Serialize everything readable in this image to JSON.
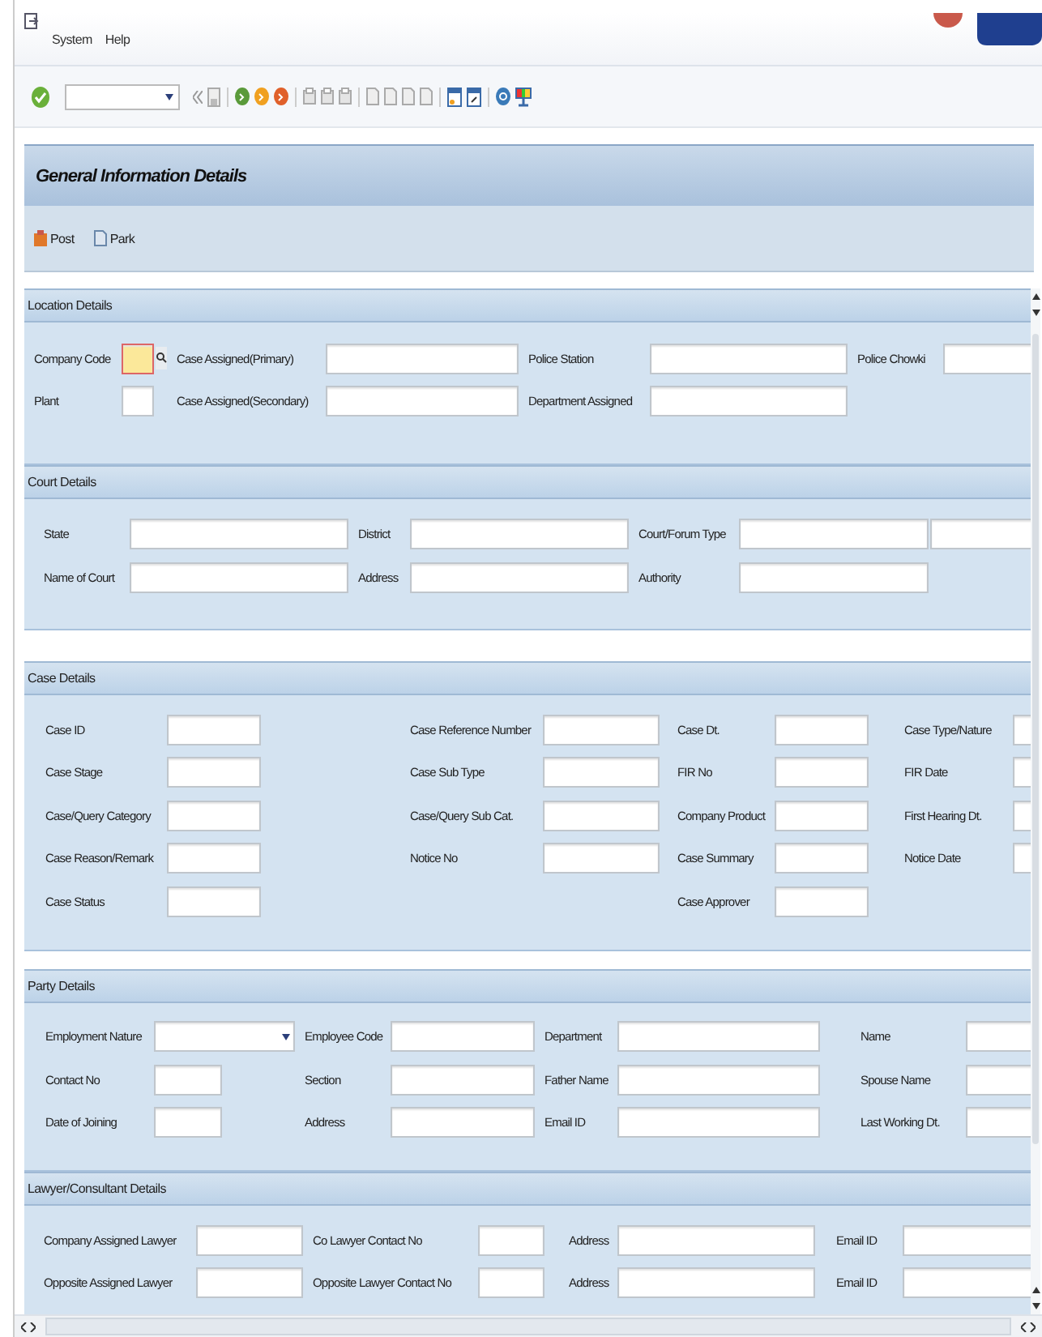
{
  "menu": [
    "System",
    "Help"
  ],
  "title": "General Information Details",
  "actions": [
    "Post",
    "Park"
  ],
  "sections": [
    {
      "title": "Location Details",
      "rows": [
        [
          {
            "label": "Company Code",
            "kind": "lookup"
          },
          {
            "label": "Case Assigned(Primary)",
            "kind": "text"
          },
          {
            "label": "Police Station",
            "kind": "text"
          },
          {
            "label": "Police Chowki",
            "kind": "text"
          }
        ],
        [
          {
            "label": "Plant",
            "kind": "text"
          },
          {
            "label": "Case Assigned(Secondary)",
            "kind": "text"
          },
          {
            "label": "Department Assigned",
            "kind": "text"
          },
          null
        ]
      ]
    },
    {
      "title": "Court Details",
      "rows": [
        [
          {
            "label": "State",
            "kind": "text"
          },
          {
            "label": "District",
            "kind": "text"
          },
          {
            "label": "Court/Forum Type",
            "kind": "double"
          }
        ],
        [
          {
            "label": "Name of Court",
            "kind": "text"
          },
          {
            "label": "Address",
            "kind": "text"
          },
          {
            "label": "Authority",
            "kind": "text"
          }
        ]
      ]
    },
    {
      "title": "Case Details",
      "rows": [
        [
          {
            "label": "Case ID",
            "kind": "text"
          },
          {
            "label": "Case Reference Number",
            "kind": "text"
          },
          {
            "label": "Case Dt.",
            "kind": "text"
          },
          {
            "label": "Case Type/Nature",
            "kind": "text"
          }
        ],
        [
          {
            "label": "Case Stage",
            "kind": "text"
          },
          {
            "label": "Case Sub Type",
            "kind": "text"
          },
          {
            "label": "FIR No",
            "kind": "text"
          },
          {
            "label": "FIR Date",
            "kind": "text"
          }
        ],
        [
          {
            "label": "Case/Query Category",
            "kind": "text"
          },
          {
            "label": "Case/Query Sub Cat.",
            "kind": "text"
          },
          {
            "label": "Company Product",
            "kind": "text"
          },
          {
            "label": "First Hearing Dt.",
            "kind": "text"
          }
        ],
        [
          {
            "label": "Case Reason/Remark",
            "kind": "text"
          },
          {
            "label": "Notice No",
            "kind": "text"
          },
          {
            "label": "Case Summary",
            "kind": "text"
          },
          {
            "label": "Notice Date",
            "kind": "text"
          }
        ],
        [
          {
            "label": "Case Status",
            "kind": "text"
          },
          null,
          {
            "label": "Case Approver",
            "kind": "text"
          },
          null
        ]
      ]
    },
    {
      "title": "Party Details",
      "rows": [
        [
          {
            "label": "Employment Nature",
            "kind": "dropdown"
          },
          {
            "label": "Employee Code",
            "kind": "text"
          },
          {
            "label": "Department",
            "kind": "text"
          },
          {
            "label": "Name",
            "kind": "text"
          }
        ],
        [
          {
            "label": "Contact No",
            "kind": "text"
          },
          {
            "label": "Section",
            "kind": "text"
          },
          {
            "label": "Father Name",
            "kind": "text"
          },
          {
            "label": "Spouse Name",
            "kind": "text"
          }
        ],
        [
          {
            "label": "Date of Joining",
            "kind": "text"
          },
          {
            "label": "Address",
            "kind": "text"
          },
          {
            "label": "Email ID",
            "kind": "text"
          },
          {
            "label": "Last Working Dt.",
            "kind": "text"
          }
        ]
      ]
    },
    {
      "title": "Lawyer/Consultant Details",
      "rows": [
        [
          {
            "label": "Company Assigned Lawyer",
            "kind": "text"
          },
          {
            "label": "Co Lawyer Contact No",
            "kind": "text"
          },
          {
            "label": "Address",
            "kind": "text"
          },
          {
            "label": "Email ID",
            "kind": "text"
          }
        ],
        [
          {
            "label": "Opposite Assigned Lawyer",
            "kind": "text"
          },
          {
            "label": "Opposite Lawyer Contact No",
            "kind": "text"
          },
          {
            "label": "Address",
            "kind": "text"
          },
          {
            "label": "Email ID",
            "kind": "text"
          }
        ]
      ]
    }
  ]
}
